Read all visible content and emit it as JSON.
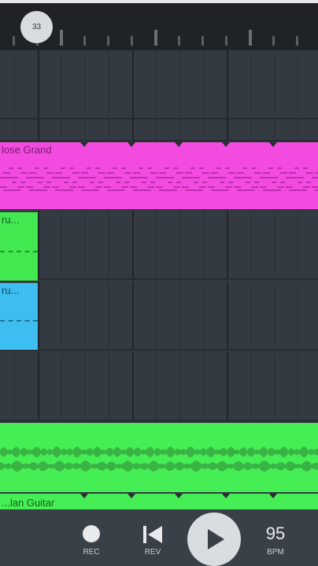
{
  "ruler": {
    "playhead_bar": "33"
  },
  "tracks": {
    "clips": [
      {
        "name": "Close Grand",
        "label": "lose Grand",
        "color": "#f34be0",
        "type": "pattern"
      },
      {
        "name": "Dru...",
        "label": "ru...",
        "color": "#41e84f",
        "type": "pattern"
      },
      {
        "name": "Dru...",
        "label": "ru...",
        "color": "#3dbdf0",
        "type": "pattern"
      },
      {
        "name": "audio",
        "label": "",
        "color": "#46ee55",
        "type": "audio"
      },
      {
        "name": "Guitar",
        "label": "...lan Guitar",
        "color": "#46ee55",
        "type": "pattern"
      }
    ]
  },
  "transport": {
    "rec_label": "REC",
    "rev_label": "REV",
    "play_icon": "play-icon",
    "bpm_value": "95",
    "bpm_label": "BPM"
  },
  "colors": {
    "background": "#343a41",
    "transport": "#3a4047",
    "magenta": "#f34be0",
    "green": "#41e84f",
    "blue": "#3dbdf0"
  }
}
